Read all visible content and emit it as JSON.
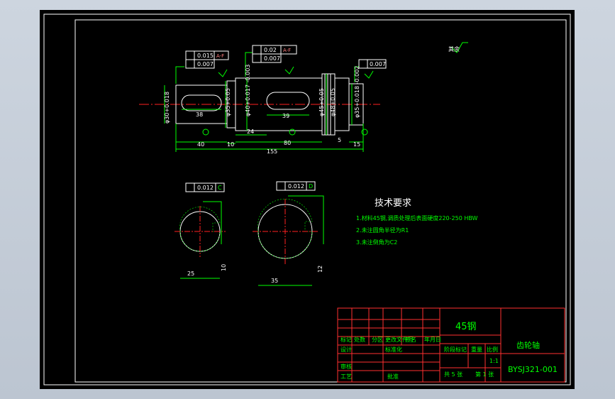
{
  "drawing": {
    "title": "技术要求",
    "requirements": [
      "1.材料45钢,调质处理后表面硬度220-250 HBW",
      "2.未注圆角半径为R1",
      "3.未注倒角为C2"
    ],
    "roughness_note": "其余"
  },
  "dimensions": {
    "tol1": "0.015",
    "tol1_ref": "A-F",
    "tol1b": "0.007",
    "tol2": "0.02",
    "tol2_ref": "A-F",
    "tol2b": "0.007",
    "tol3": "0.007",
    "d_left": "φ30+0.018",
    "d_35": "φ35+0.05",
    "d_40": "φ40+0.017 -0.003",
    "d_45": "φ45+0.05",
    "d_48": "φ48+0.05",
    "d_right": "φ35+0.018 -0.002",
    "len_38": "38",
    "len_39": "39",
    "len_24": "24",
    "len_40": "40",
    "len_10": "10",
    "len_80": "80",
    "len_5": "5",
    "len_15": "15",
    "len_155": "155",
    "sec1_tol": "0.012",
    "sec1_ref": "C",
    "sec2_tol": "0.012",
    "sec2_ref": "D",
    "sec1_w": "25",
    "sec1_w2": "10",
    "sec2_w": "35",
    "sec2_w2": "12"
  },
  "title_block": {
    "material": "45钢",
    "part_name": "齿轮轴",
    "drawing_no": "BYSJ321-001",
    "scale": "1:1",
    "sheet_info": "共 5 张",
    "sheet_no": "第 1 张",
    "headers": [
      "标记",
      "处数",
      "分区",
      "更改文件号",
      "签名",
      "年月日"
    ],
    "row_design": "设计",
    "row_check": "审核",
    "row_process": "工艺",
    "row_approve": "批准",
    "stage_label": "阶段标记",
    "weight_label": "重量",
    "scale_label": "比例",
    "std_label": "标准化"
  },
  "colors": {
    "line": "#00ff00",
    "outline": "#ffffff",
    "center": "#ff2020",
    "table": "#ff3030"
  }
}
